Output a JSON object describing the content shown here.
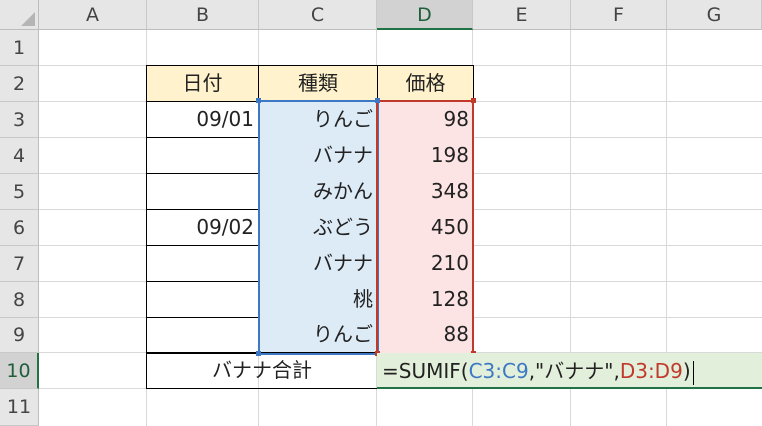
{
  "columns": [
    "A",
    "B",
    "C",
    "D",
    "E",
    "F",
    "G"
  ],
  "active_column": "D",
  "rows": [
    "1",
    "2",
    "3",
    "4",
    "5",
    "6",
    "7",
    "8",
    "9",
    "10",
    "11"
  ],
  "active_row": "10",
  "table": {
    "headers": {
      "date": "日付",
      "kind": "種類",
      "price": "価格"
    },
    "data_rows": [
      {
        "date": "09/01",
        "kind": "りんご",
        "price": "98"
      },
      {
        "date": "",
        "kind": "バナナ",
        "price": "198"
      },
      {
        "date": "",
        "kind": "みかん",
        "price": "348"
      },
      {
        "date": "09/02",
        "kind": "ぶどう",
        "price": "450"
      },
      {
        "date": "",
        "kind": "バナナ",
        "price": "210"
      },
      {
        "date": "",
        "kind": "桃",
        "price": "128"
      },
      {
        "date": "",
        "kind": "りんご",
        "price": "88"
      }
    ],
    "total_label": "バナナ合計"
  },
  "formula": {
    "prefix": "=SUMIF(",
    "range_ref": "C3:C9",
    "criteria": ",\"バナナ\",",
    "sum_ref": "D3:D9",
    "suffix": ")"
  },
  "colors": {
    "header_fill": "#fff2cc",
    "range_blue": "#3c78c4",
    "range_red": "#c0392b",
    "active_green": "#217346",
    "active_fill": "#e2efda"
  }
}
